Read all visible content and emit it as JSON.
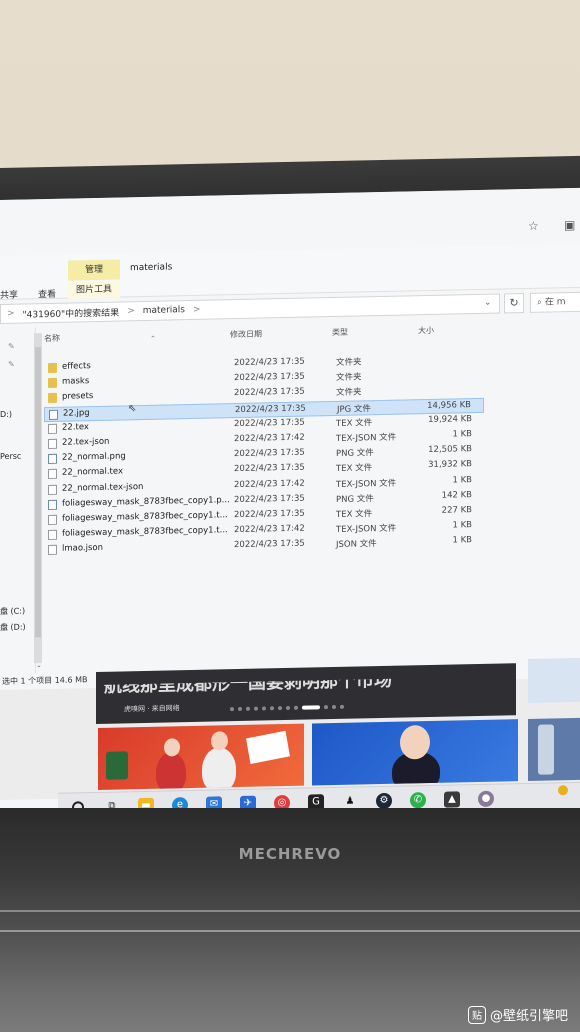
{
  "window": {
    "ribbon": {
      "manage_tab": "管理",
      "title": "materials",
      "share_tab": "共享",
      "view_tab": "查看",
      "picture_tools": "图片工具"
    },
    "address": {
      "crumb_search": "\"431960\"中的搜索结果",
      "crumb_folder": "materials",
      "separator": ">"
    },
    "search_placeholder": "在 m",
    "nav": {
      "item_d": "D:)",
      "item_persc": "Persc",
      "drive_c": "盘 (C:)",
      "drive_d": "盘 (D:)"
    },
    "columns": {
      "name": "名称",
      "date": "修改日期",
      "type": "类型",
      "size": "大小"
    },
    "files": [
      {
        "name": "effects",
        "date": "2022/4/23 17:35",
        "type": "文件夹",
        "size": "",
        "icon": "folder-icon"
      },
      {
        "name": "masks",
        "date": "2022/4/23 17:35",
        "type": "文件夹",
        "size": "",
        "icon": "folder-icon"
      },
      {
        "name": "presets",
        "date": "2022/4/23 17:35",
        "type": "文件夹",
        "size": "",
        "icon": "folder-icon"
      },
      {
        "name": "22.jpg",
        "date": "2022/4/23 17:35",
        "type": "JPG 文件",
        "size": "14,956 KB",
        "icon": "image-file-icon",
        "selected": true
      },
      {
        "name": "22.tex",
        "date": "2022/4/23 17:35",
        "type": "TEX 文件",
        "size": "19,924 KB",
        "icon": "file-icon"
      },
      {
        "name": "22.tex-json",
        "date": "2022/4/23 17:42",
        "type": "TEX-JSON 文件",
        "size": "1 KB",
        "icon": "file-icon"
      },
      {
        "name": "22_normal.png",
        "date": "2022/4/23 17:35",
        "type": "PNG 文件",
        "size": "12,505 KB",
        "icon": "image-file-icon"
      },
      {
        "name": "22_normal.tex",
        "date": "2022/4/23 17:35",
        "type": "TEX 文件",
        "size": "31,932 KB",
        "icon": "file-icon"
      },
      {
        "name": "22_normal.tex-json",
        "date": "2022/4/23 17:42",
        "type": "TEX-JSON 文件",
        "size": "1 KB",
        "icon": "file-icon"
      },
      {
        "name": "foliagesway_mask_8783fbec_copy1.p...",
        "date": "2022/4/23 17:35",
        "type": "PNG 文件",
        "size": "142 KB",
        "icon": "image-file-icon"
      },
      {
        "name": "foliagesway_mask_8783fbec_copy1.t...",
        "date": "2022/4/23 17:35",
        "type": "TEX 文件",
        "size": "227 KB",
        "icon": "file-icon"
      },
      {
        "name": "foliagesway_mask_8783fbec_copy1.t...",
        "date": "2022/4/23 17:42",
        "type": "TEX-JSON 文件",
        "size": "1 KB",
        "icon": "file-icon"
      },
      {
        "name": "lmao.json",
        "date": "2022/4/23 17:35",
        "type": "JSON 文件",
        "size": "1 KB",
        "icon": "file-icon"
      }
    ],
    "status": "选中 1 个项目  14.6 MB"
  },
  "web": {
    "headline": "航线那里成都形一国要剥明那个市场",
    "source": "虎嗅网 · 来自网络"
  },
  "taskbar_icons": [
    "search-icon",
    "task-view-icon",
    "file-explorer-icon",
    "edge-icon",
    "mail-icon",
    "feishu-icon",
    "netease-music-icon",
    "app-g-icon",
    "qq-icon",
    "steam-icon",
    "wechat-icon",
    "wallpaper-engine-icon",
    "avatar-app-icon"
  ],
  "laptop": {
    "brand": "MECHREVO"
  },
  "watermark": "@壁纸引擎吧",
  "colors": {
    "selection": "#cfe3f8",
    "manage_tab": "#f5eda6",
    "folder": "#e8c04c"
  }
}
